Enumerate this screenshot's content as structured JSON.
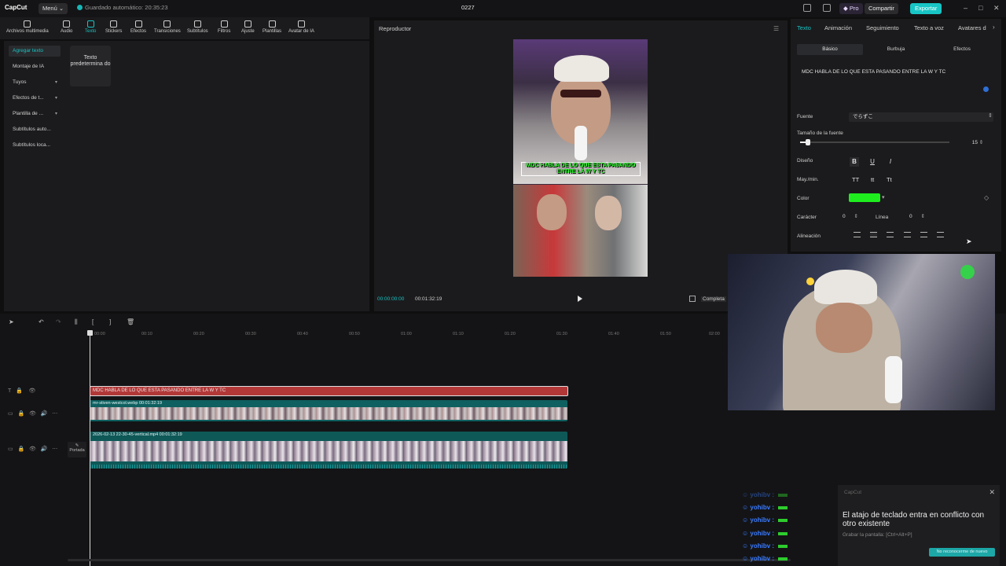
{
  "titlebar": {
    "logo": "CapCut",
    "menu_label": "Menú ⌄",
    "autosave": "Guardado automático: 20:35:23",
    "project_title": "0227",
    "pro_label": "◆ Pro",
    "share_label": "Compartir",
    "export_label": "Exportar"
  },
  "media_toolbar": {
    "items": [
      {
        "label": "Archivos multimedia"
      },
      {
        "label": "Audio"
      },
      {
        "label": "Texto"
      },
      {
        "label": "Stickers"
      },
      {
        "label": "Efectos"
      },
      {
        "label": "Transiciones"
      },
      {
        "label": "Subtítulos"
      },
      {
        "label": "Filtros"
      },
      {
        "label": "Ajuste"
      },
      {
        "label": "Plantillas"
      },
      {
        "label": "Avatar de IA"
      }
    ]
  },
  "left_panel": {
    "items": [
      {
        "label": "Agregar texto"
      },
      {
        "label": "Montaje de IA"
      },
      {
        "label": "Tuyos"
      },
      {
        "label": "Efectos de t..."
      },
      {
        "label": "Plantilla de ..."
      },
      {
        "label": "Subtítulos auto..."
      },
      {
        "label": "Subtítulos loca..."
      }
    ],
    "default_text_card": "Texto predetermina do"
  },
  "player": {
    "title": "Reproductor",
    "caption": "MDC HABLA DE LO QUE ESTA PASANDO ENTRE LA W Y TC",
    "current_time": "00:00:00:00",
    "total_time": "00:01:32:19",
    "ratio_label": "Completa"
  },
  "right_panel": {
    "tabs": [
      {
        "label": "Texto"
      },
      {
        "label": "Animación"
      },
      {
        "label": "Seguimiento"
      },
      {
        "label": "Texto a voz"
      },
      {
        "label": "Avatares d"
      }
    ],
    "subtabs": [
      {
        "label": "Básico"
      },
      {
        "label": "Burbuja"
      },
      {
        "label": "Efectos"
      }
    ],
    "text_value": "MDC HABLA DE LO QUE ESTA PASANDO  ENTRE LA W Y TC",
    "font_label": "Fuente",
    "font_value": "でらずこ",
    "size_label": "Tamaño de la fuente",
    "size_value": "15",
    "size_fraction": 0.05,
    "design_label": "Diseño",
    "case_label": "May./min.",
    "case_buttons": [
      "TT",
      "tt",
      "Tt"
    ],
    "color_label": "Color",
    "color_value": "#1eee1e",
    "char_label": "Carácter",
    "char_value": "0",
    "line_label": "Línea",
    "line_value": "0",
    "align_label": "Alineación"
  },
  "timeline": {
    "ticks": [
      "00:00",
      "00:10",
      "00:20",
      "00:30",
      "00:40",
      "00:50",
      "01:00",
      "01:10",
      "01:20",
      "01:30",
      "01:40",
      "01:50",
      "02:00"
    ],
    "text_clip": "MDC HABLA DE LO QUE ESTA PASANDO  ENTRE LA W Y TC",
    "clip1_label": "mr-stiven-westcol.webp   00:01:32:19",
    "clip2_label": "2026-02-13 22-30-45-vertical.mp4   00:01:32:19",
    "cover_label": "Portada"
  },
  "chat": {
    "rows": [
      {
        "user": "yohibv :",
        "faded": true
      },
      {
        "user": "yohibv :"
      },
      {
        "user": "yohibv :"
      },
      {
        "user": "yohibv :"
      },
      {
        "user": "yohibv :"
      },
      {
        "user": "yohibv :"
      }
    ]
  },
  "notification": {
    "header": "CapCut",
    "message": "El atajo de teclado entra en conflicto con otro existente",
    "sub": "Grabar la pantalla: [Ctrl+Alt+P]",
    "button": "No reconocerme de nuevo"
  }
}
